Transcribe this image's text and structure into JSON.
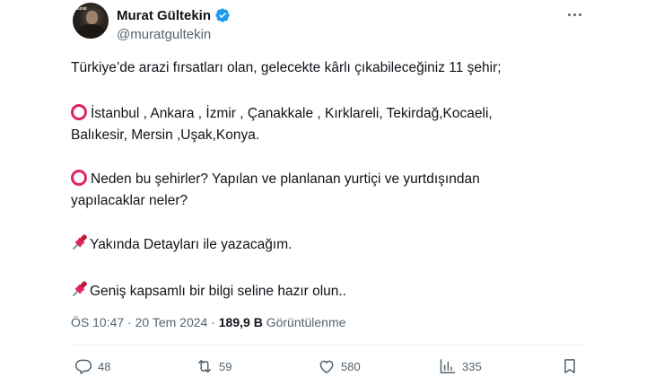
{
  "author": {
    "name": "Murat Gültekin",
    "handle": "@muratgultekin",
    "avatar_text": "Murat"
  },
  "tweet": {
    "line1": "Türkiye’de arazi fırsatları olan, gelecekte kârlı çıkabileceğiniz 11 şehir;",
    "line2": "İstanbul , Ankara , İzmir , Çanakkale , Kırklareli, Tekirdağ,Kocaeli,",
    "line3": "Balıkesir, Mersin ,Uşak,Konya.",
    "line4": "Neden bu şehirler? Yapılan ve planlanan yurtiçi ve yurtdışından",
    "line5": "yapılacaklar neler?",
    "line6": "Yakında Detayları ile  yazacağım.",
    "line7": "Geniş kapsamlı bir bilgi seline hazır olun.."
  },
  "meta": {
    "time": "ÖS 10:47",
    "separator": " · ",
    "date": "20 Tem 2024",
    "views_count": "189,9 B",
    "views_label": "Görüntülenme"
  },
  "actions": {
    "replies": "48",
    "retweets": "59",
    "likes": "580",
    "views": "335"
  },
  "colors": {
    "verified": "#1d9bf0",
    "circle_emoji": "#e0245e",
    "pin_emoji": "#e0245e",
    "secondary_text": "#536471"
  },
  "icons": [
    "verified-badge-icon",
    "more-icon",
    "hollow-red-circle-icon",
    "pushpin-icon",
    "reply-icon",
    "retweet-icon",
    "like-icon",
    "views-icon",
    "bookmark-icon",
    "share-icon"
  ]
}
